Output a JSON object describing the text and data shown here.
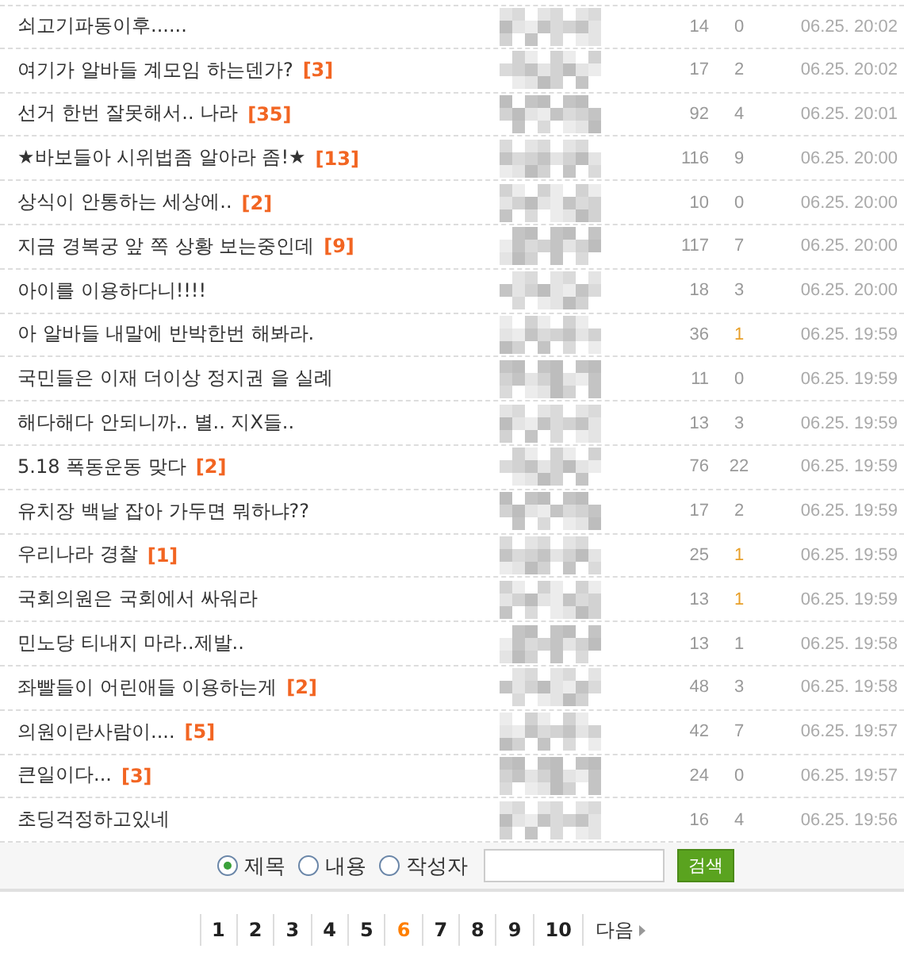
{
  "rows": [
    {
      "title": "쇠고기파동이후......",
      "replies": "",
      "views": "14",
      "votes": "0",
      "vote_highlight": false,
      "date": "06.25. 20:02"
    },
    {
      "title": "여기가 알바들 계모임 하는덴가?",
      "replies": "[3]",
      "views": "17",
      "votes": "2",
      "vote_highlight": false,
      "date": "06.25. 20:02"
    },
    {
      "title": "선거 한번 잘못해서.. 나라",
      "replies": "[35]",
      "views": "92",
      "votes": "4",
      "vote_highlight": false,
      "date": "06.25. 20:01"
    },
    {
      "title": "★바보들아 시위법좀 알아라 좀!★",
      "replies": "[13]",
      "views": "116",
      "votes": "9",
      "vote_highlight": false,
      "date": "06.25. 20:00"
    },
    {
      "title": "상식이 안통하는 세상에..",
      "replies": "[2]",
      "views": "10",
      "votes": "0",
      "vote_highlight": false,
      "date": "06.25. 20:00"
    },
    {
      "title": "지금 경복궁 앞 쪽 상황 보는중인데",
      "replies": "[9]",
      "views": "117",
      "votes": "7",
      "vote_highlight": false,
      "date": "06.25. 20:00"
    },
    {
      "title": "아이를 이용하다니!!!!",
      "replies": "",
      "views": "18",
      "votes": "3",
      "vote_highlight": false,
      "date": "06.25. 20:00"
    },
    {
      "title": "아 알바들 내말에 반박한번 해봐라.",
      "replies": "",
      "views": "36",
      "votes": "1",
      "vote_highlight": true,
      "date": "06.25. 19:59"
    },
    {
      "title": "국민들은 이재 더이상 정지권 을 실례",
      "replies": "",
      "views": "11",
      "votes": "0",
      "vote_highlight": false,
      "date": "06.25. 19:59"
    },
    {
      "title": "해다해다 안되니까.. 별.. 지X들..",
      "replies": "",
      "views": "13",
      "votes": "3",
      "vote_highlight": false,
      "date": "06.25. 19:59"
    },
    {
      "title": "5.18 폭동운동 맞다",
      "replies": "[2]",
      "views": "76",
      "votes": "22",
      "vote_highlight": false,
      "date": "06.25. 19:59"
    },
    {
      "title": "유치장 백날 잡아 가두면 뭐하냐??",
      "replies": "",
      "views": "17",
      "votes": "2",
      "vote_highlight": false,
      "date": "06.25. 19:59"
    },
    {
      "title": "우리나라 경찰",
      "replies": "[1]",
      "views": "25",
      "votes": "1",
      "vote_highlight": true,
      "date": "06.25. 19:59"
    },
    {
      "title": "국회의원은 국회에서 싸워라",
      "replies": "",
      "views": "13",
      "votes": "1",
      "vote_highlight": true,
      "date": "06.25. 19:59"
    },
    {
      "title": "민노당 티내지 마라..제발..",
      "replies": "",
      "views": "13",
      "votes": "1",
      "vote_highlight": false,
      "date": "06.25. 19:58"
    },
    {
      "title": "좌빨들이 어린애들 이용하는게",
      "replies": "[2]",
      "views": "48",
      "votes": "3",
      "vote_highlight": false,
      "date": "06.25. 19:58"
    },
    {
      "title": "의원이란사람이....",
      "replies": "[5]",
      "views": "42",
      "votes": "7",
      "vote_highlight": false,
      "date": "06.25. 19:57"
    },
    {
      "title": "큰일이다...",
      "replies": "[3]",
      "views": "24",
      "votes": "0",
      "vote_highlight": false,
      "date": "06.25. 19:57"
    },
    {
      "title": "초딩걱정하고있네",
      "replies": "",
      "views": "16",
      "votes": "4",
      "vote_highlight": false,
      "date": "06.25. 19:56"
    }
  ],
  "search": {
    "options": [
      {
        "label": "제목",
        "selected": true
      },
      {
        "label": "내용",
        "selected": false
      },
      {
        "label": "작성자",
        "selected": false
      }
    ],
    "button": "검색"
  },
  "pagination": {
    "pages": [
      {
        "label": "1",
        "selected": false
      },
      {
        "label": "2",
        "selected": false
      },
      {
        "label": "3",
        "selected": false
      },
      {
        "label": "4",
        "selected": false
      },
      {
        "label": "5",
        "selected": false
      },
      {
        "label": "6",
        "selected": true
      },
      {
        "label": "7",
        "selected": false
      },
      {
        "label": "8",
        "selected": false
      },
      {
        "label": "9",
        "selected": false
      },
      {
        "label": "10",
        "selected": false
      }
    ],
    "next": "다음"
  }
}
